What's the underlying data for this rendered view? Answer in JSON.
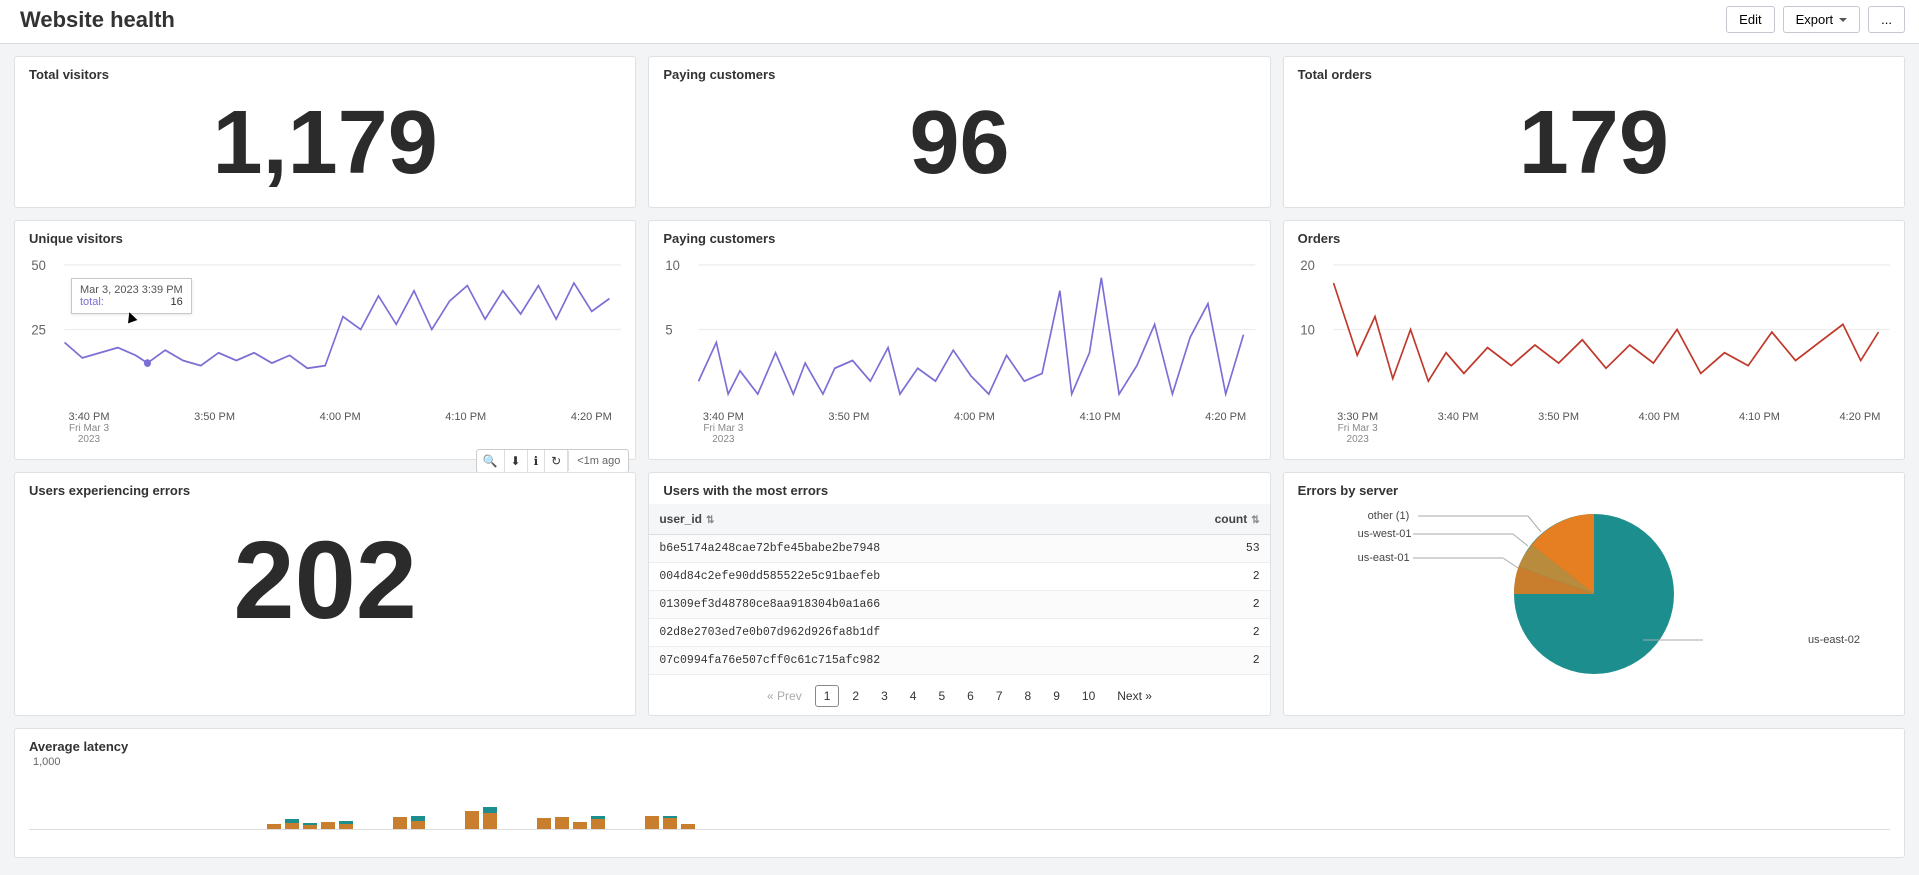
{
  "header": {
    "title": "Website health",
    "edit": "Edit",
    "export": "Export",
    "more": "..."
  },
  "stats": {
    "total_visitors": {
      "title": "Total visitors",
      "value": "1,179"
    },
    "paying_customers": {
      "title": "Paying customers",
      "value": "96"
    },
    "total_orders": {
      "title": "Total orders",
      "value": "179"
    },
    "errors_users": {
      "title": "Users experiencing errors",
      "value": "202"
    }
  },
  "charts": {
    "unique_visitors": {
      "title": "Unique visitors",
      "yticks": [
        "50",
        "25"
      ],
      "xlabels": [
        "3:40 PM",
        "3:50 PM",
        "4:00 PM",
        "4:10 PM",
        "4:20 PM"
      ],
      "xsub_line1": "Fri Mar 3",
      "xsub_line2": "2023",
      "tooltip": {
        "ts": "Mar 3, 2023 3:39 PM",
        "label": "total:",
        "value": "16"
      },
      "toolbar_time": "<1m ago"
    },
    "paying_customers_ts": {
      "title": "Paying customers",
      "yticks": [
        "10",
        "5"
      ],
      "xlabels": [
        "3:40 PM",
        "3:50 PM",
        "4:00 PM",
        "4:10 PM",
        "4:20 PM"
      ],
      "xsub_line1": "Fri Mar 3",
      "xsub_line2": "2023"
    },
    "orders_ts": {
      "title": "Orders",
      "yticks": [
        "20",
        "10"
      ],
      "xlabels": [
        "3:30 PM",
        "3:40 PM",
        "3:50 PM",
        "4:00 PM",
        "4:10 PM",
        "4:20 PM"
      ],
      "xsub_line1": "Fri Mar 3",
      "xsub_line2": "2023"
    },
    "latency": {
      "title": "Average latency",
      "ytick": "1,000"
    }
  },
  "table": {
    "title": "Users with the most errors",
    "col_user": "user_id",
    "col_count": "count",
    "rows": [
      {
        "user_id": "b6e5174a248cae72bfe45babe2be7948",
        "count": "53"
      },
      {
        "user_id": "004d84c2efe90dd585522e5c91baefeb",
        "count": "2"
      },
      {
        "user_id": "01309ef3d48780ce8aa918304b0a1a66",
        "count": "2"
      },
      {
        "user_id": "02d8e2703ed7e0b07d962d926fa8b1df",
        "count": "2"
      },
      {
        "user_id": "07c0994fa76e507cff0c61c715afc982",
        "count": "2"
      }
    ],
    "pager": {
      "prev": "« Prev",
      "next": "Next »",
      "pages": [
        "1",
        "2",
        "3",
        "4",
        "5",
        "6",
        "7",
        "8",
        "9",
        "10"
      ]
    }
  },
  "pie": {
    "title": "Errors by server",
    "labels": {
      "other": "other (1)",
      "uswest": "us-west-01",
      "useast1": "us-east-01",
      "useast2": "us-east-02"
    }
  },
  "chart_data": [
    {
      "type": "line",
      "title": "Unique visitors",
      "ylim": [
        0,
        50
      ],
      "x": [
        "3:35",
        "3:40",
        "3:45",
        "3:50",
        "3:55",
        "4:00",
        "4:05",
        "4:10",
        "4:15",
        "4:20",
        "4:25"
      ],
      "series": [
        {
          "name": "total",
          "values": [
            22,
            16,
            21,
            19,
            18,
            23,
            34,
            30,
            38,
            32,
            36
          ]
        }
      ],
      "tooltip_point": {
        "ts": "Mar 3, 2023 3:39 PM",
        "value": 16
      }
    },
    {
      "type": "line",
      "title": "Paying customers",
      "ylim": [
        0,
        10
      ],
      "x": [
        "3:35",
        "3:40",
        "3:45",
        "3:50",
        "3:55",
        "4:00",
        "4:05",
        "4:10",
        "4:15",
        "4:20",
        "4:25"
      ],
      "series": [
        {
          "name": "count",
          "values": [
            2,
            1,
            3,
            2,
            1,
            3,
            2,
            4,
            7,
            3,
            5
          ]
        }
      ]
    },
    {
      "type": "line",
      "title": "Orders",
      "ylim": [
        0,
        20
      ],
      "x": [
        "3:30",
        "3:40",
        "3:50",
        "4:00",
        "4:10",
        "4:20"
      ],
      "series": [
        {
          "name": "count",
          "values": [
            18,
            6,
            8,
            6,
            7,
            9
          ]
        }
      ]
    },
    {
      "type": "pie",
      "title": "Errors by server",
      "categories": [
        "us-east-02",
        "us-east-01",
        "us-west-01",
        "other"
      ],
      "values": [
        70,
        15,
        12,
        3
      ]
    },
    {
      "type": "bar",
      "title": "Average latency",
      "ylim": [
        0,
        1000
      ],
      "stacked": true,
      "series": [
        {
          "name": "A",
          "values": [
            0,
            0,
            0,
            0,
            0,
            0,
            0,
            0,
            0,
            0,
            0,
            80,
            100,
            60,
            120,
            80,
            0,
            0,
            200,
            140,
            0,
            0,
            300,
            260,
            0,
            0,
            180,
            200,
            120,
            160,
            0,
            0,
            220,
            180,
            80,
            0,
            0,
            0,
            0,
            0
          ]
        },
        {
          "name": "B",
          "values": [
            0,
            0,
            0,
            0,
            0,
            0,
            0,
            0,
            0,
            0,
            0,
            0,
            60,
            40,
            0,
            60,
            0,
            0,
            0,
            80,
            0,
            0,
            0,
            100,
            0,
            0,
            0,
            0,
            0,
            60,
            0,
            0,
            0,
            40,
            0,
            0,
            0,
            0,
            0,
            0
          ]
        }
      ]
    }
  ]
}
